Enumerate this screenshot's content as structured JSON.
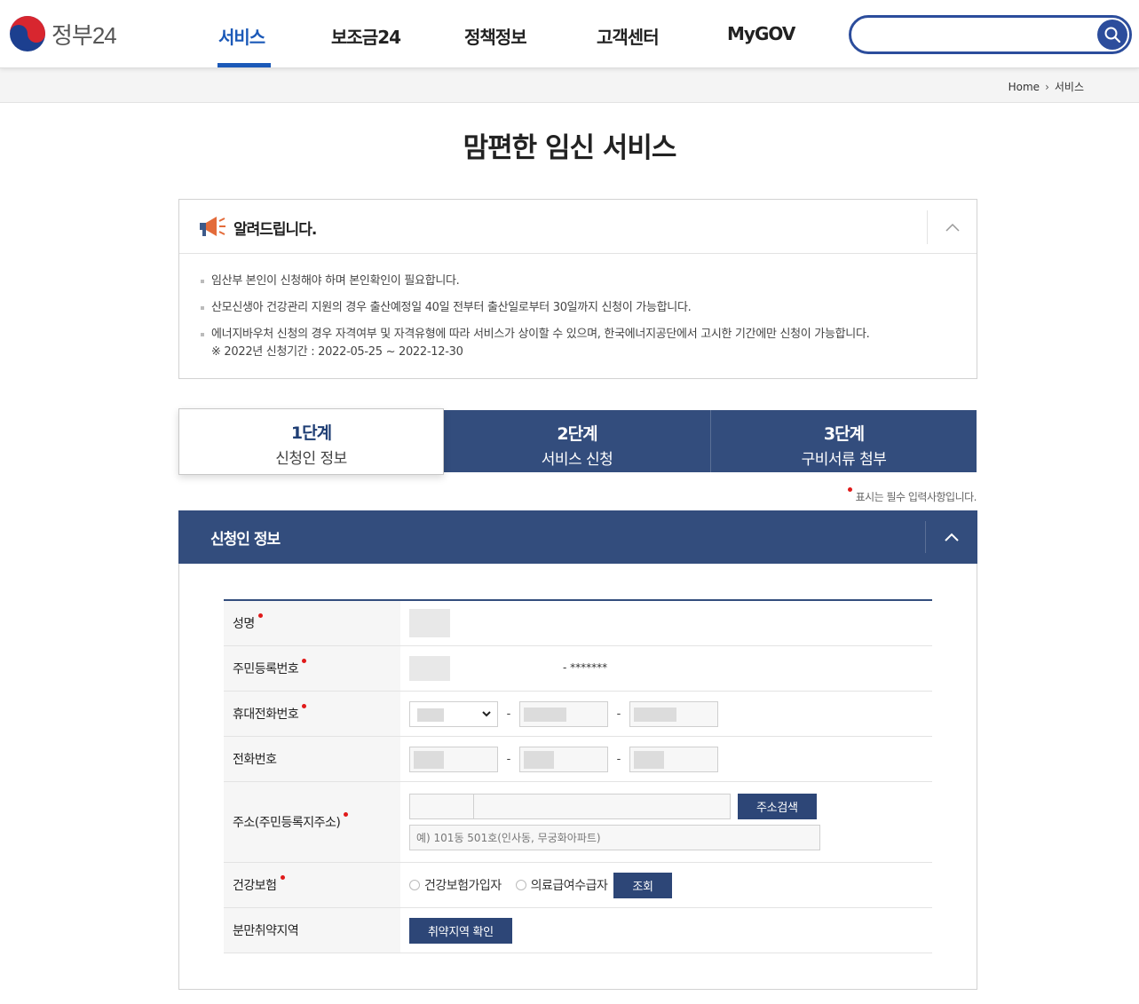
{
  "header": {
    "logo_text": "정부24",
    "nav": [
      {
        "label": "서비스"
      },
      {
        "label": "보조금24"
      },
      {
        "label": "정책정보"
      },
      {
        "label": "고객센터"
      },
      {
        "label": "MyGOV"
      }
    ],
    "search": {
      "placeholder": ""
    },
    "accent_color": "#1b59b8"
  },
  "breadcrumb": {
    "home": "Home",
    "current": "서비스"
  },
  "page_title": "맘편한 임신 서비스",
  "notice": {
    "title": "알려드립니다.",
    "items": [
      "임산부 본인이 신청해야 하며 본인확인이 필요합니다.",
      "산모신생아 건강관리 지원의 경우 출산예정일 40일 전부터 출산일로부터 30일까지 신청이 가능합니다.",
      "에너지바우처 신청의 경우 자격여부 및 자격유형에 따라 서비스가 상이할 수 있으며, 한국에너지공단에서 고시한 기간에만 신청이 가능합니다."
    ],
    "sub_note": "※ 2022년 신청기간 : 2022-05-25 ~ 2022-12-30"
  },
  "steps": [
    {
      "num": "1단계",
      "label": "신청인 정보"
    },
    {
      "num": "2단계",
      "label": "서비스 신청"
    },
    {
      "num": "3단계",
      "label": "구비서류 첨부"
    }
  ],
  "required_note": "표시는 필수 입력사항입니다.",
  "section": {
    "title": "신청인 정보",
    "rows": {
      "name": "성명",
      "rrn": "주민등록번호",
      "rrn_back": "- *******",
      "mobile": "휴대전화번호",
      "phone": "전화번호",
      "address": "주소(주민등록지주소)",
      "address_button": "주소검색",
      "address_placeholder": "예) 101동 501호(인사동, 무궁화아파트)",
      "insurance": "건강보험",
      "insurance_opt1": "건강보험가입자",
      "insurance_opt2": "의료급여수급자",
      "insurance_button": "조회",
      "birth_area": "분만취약지역",
      "birth_area_button": "취약지역 확인"
    }
  },
  "colors": {
    "primary": "#334d7d",
    "required": "#e01a1a"
  }
}
